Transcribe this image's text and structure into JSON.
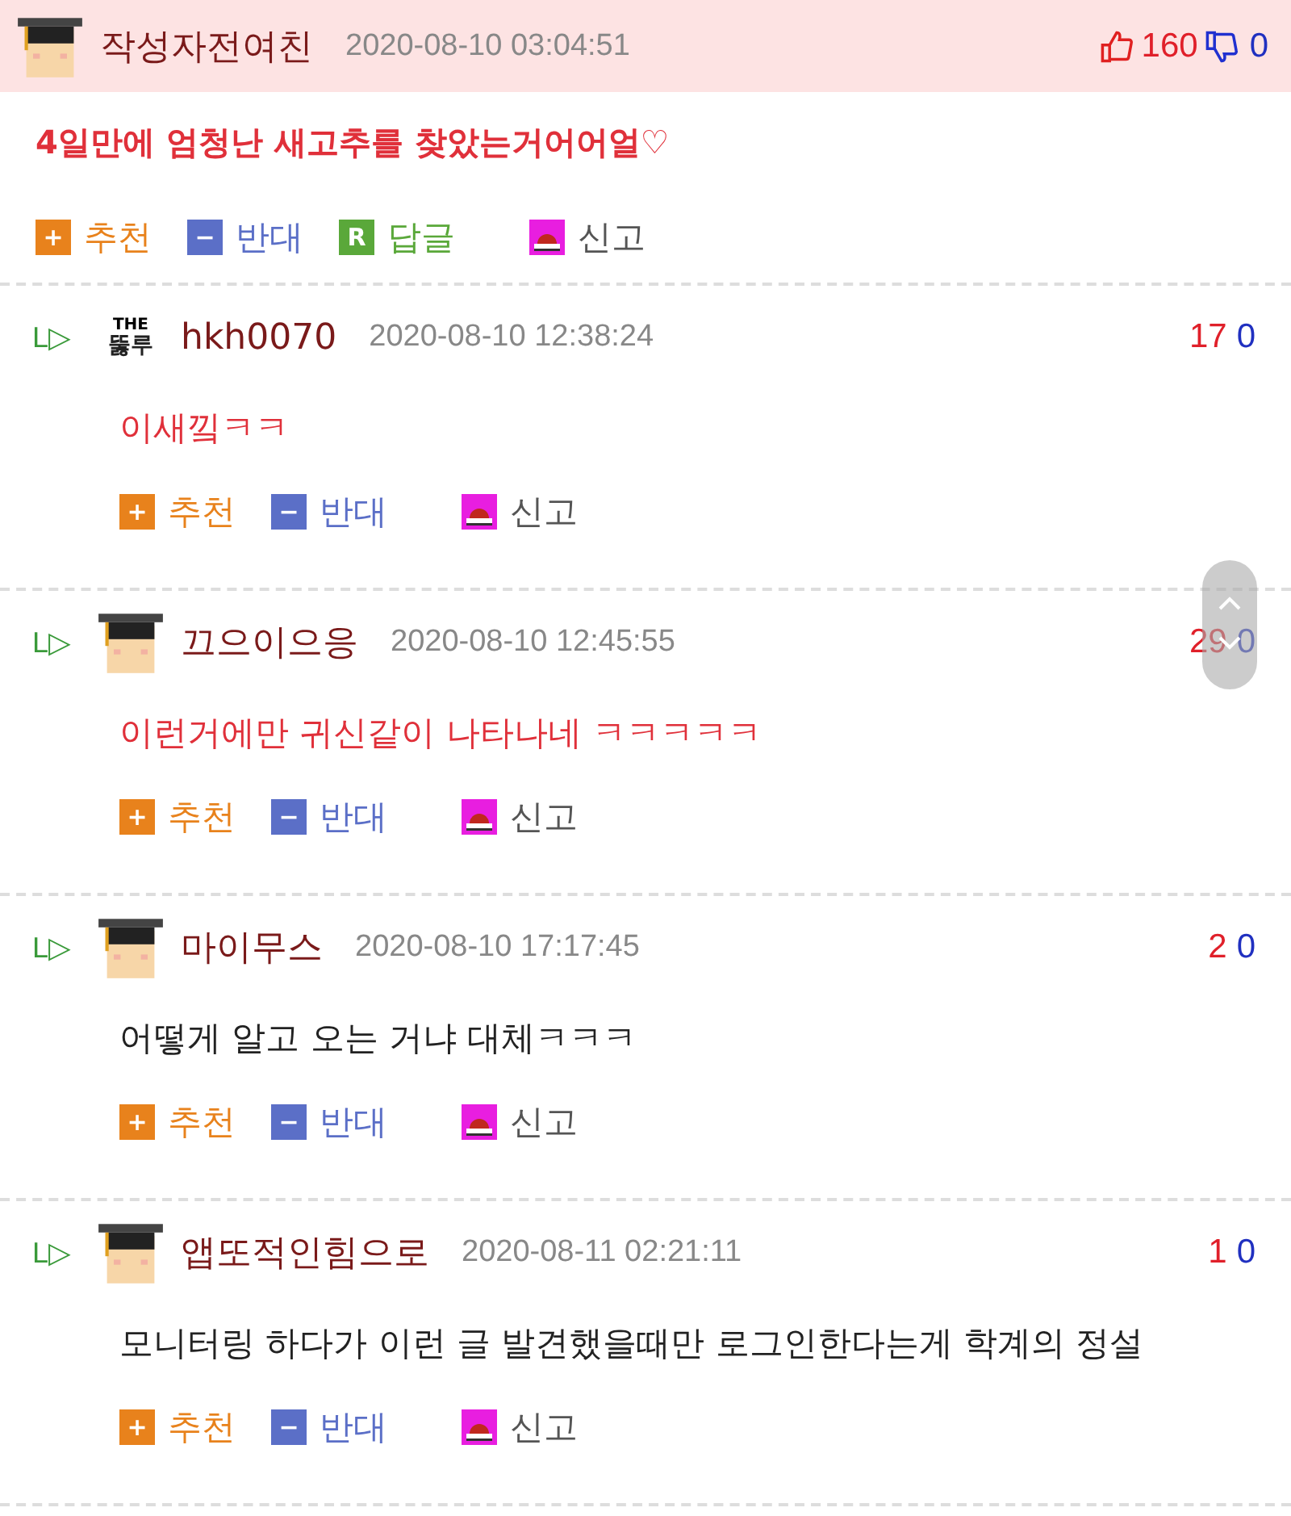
{
  "post": {
    "author": "작성자전여친",
    "avatar": {
      "kind": "pixel"
    },
    "date": "2020-08-10 03:04:51",
    "likes": "160",
    "dislikes": "0",
    "text": "4일만에 엄청난 새고추를 찾았는거어어얼♡",
    "actions": [
      {
        "kind": "up",
        "icon": "+",
        "label": "추천"
      },
      {
        "kind": "down",
        "icon": "−",
        "label": "반대"
      },
      {
        "kind": "reply",
        "icon": "R",
        "label": "답글"
      },
      {
        "kind": "report",
        "label": "신고"
      }
    ]
  },
  "replies": [
    {
      "reply_mark": "L▷",
      "avatar": {
        "kind": "logo",
        "lines": [
          "THE",
          "뚫루"
        ]
      },
      "author": "hkh0070",
      "date": "2020-08-10 12:38:24",
      "likes": "17",
      "dislikes": "0",
      "text": "이새낔ㅋㅋ",
      "emphasized": true,
      "actions": [
        {
          "kind": "up",
          "icon": "+",
          "label": "추천"
        },
        {
          "kind": "down",
          "icon": "−",
          "label": "반대"
        },
        {
          "kind": "report",
          "label": "신고"
        }
      ]
    },
    {
      "reply_mark": "L▷",
      "avatar": {
        "kind": "pixel"
      },
      "author": "끄으이으응",
      "date": "2020-08-10 12:45:55",
      "likes": "29",
      "dislikes": "0",
      "text": "이런거에만 귀신같이 나타나네 ㅋㅋㅋㅋㅋ",
      "emphasized": true,
      "actions": [
        {
          "kind": "up",
          "icon": "+",
          "label": "추천"
        },
        {
          "kind": "down",
          "icon": "−",
          "label": "반대"
        },
        {
          "kind": "report",
          "label": "신고"
        }
      ]
    },
    {
      "reply_mark": "L▷",
      "avatar": {
        "kind": "pixel"
      },
      "author": "마이무스",
      "date": "2020-08-10 17:17:45",
      "likes": "2",
      "dislikes": "0",
      "text": "어떻게 알고 오는 거냐 대체ㅋㅋㅋ",
      "emphasized": false,
      "actions": [
        {
          "kind": "up",
          "icon": "+",
          "label": "추천"
        },
        {
          "kind": "down",
          "icon": "−",
          "label": "반대"
        },
        {
          "kind": "report",
          "label": "신고"
        }
      ]
    },
    {
      "reply_mark": "L▷",
      "avatar": {
        "kind": "pixel"
      },
      "author": "앱또적인힘으로",
      "date": "2020-08-11 02:21:11",
      "likes": "1",
      "dislikes": "0",
      "text": "모니터링 하다가 이런 글 발견했을때만 로그인한다는게 학계의 정설",
      "emphasized": false,
      "actions": [
        {
          "kind": "up",
          "icon": "+",
          "label": "추천"
        },
        {
          "kind": "down",
          "icon": "−",
          "label": "반대"
        },
        {
          "kind": "report",
          "label": "신고"
        }
      ]
    }
  ]
}
